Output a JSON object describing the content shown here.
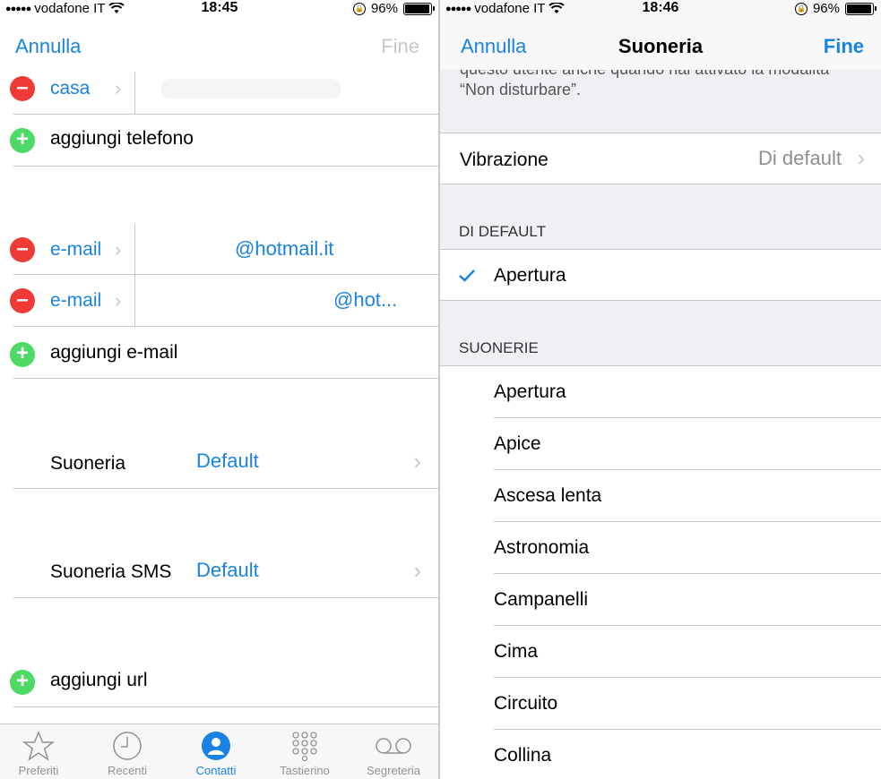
{
  "left": {
    "status": {
      "carrier": "vodafone IT",
      "time": "18:45",
      "battery": "96%"
    },
    "nav": {
      "cancel": "Annulla",
      "done": "Fine"
    },
    "phone_row": {
      "label": "casa"
    },
    "add_phone": "aggiungi telefono",
    "emails": [
      {
        "label": "e-mail",
        "value": "@hotmail.it"
      },
      {
        "label": "e-mail",
        "value": "@hot..."
      }
    ],
    "add_email": "aggiungi e-mail",
    "ringtone": {
      "label": "Suoneria",
      "value": "Default"
    },
    "sms_tone": {
      "label": "Suoneria SMS",
      "value": "Default"
    },
    "add_url": "aggiungi url",
    "tabs": [
      {
        "label": "Preferiti",
        "icon": "star-icon",
        "active": false
      },
      {
        "label": "Recenti",
        "icon": "clock-icon",
        "active": false
      },
      {
        "label": "Contatti",
        "icon": "person-icon",
        "active": true
      },
      {
        "label": "Tastierino",
        "icon": "keypad-icon",
        "active": false
      },
      {
        "label": "Segreteria",
        "icon": "voicemail-icon",
        "active": false
      }
    ]
  },
  "right": {
    "status": {
      "carrier": "vodafone IT",
      "time": "18:46",
      "battery": "96%"
    },
    "nav": {
      "cancel": "Annulla",
      "title": "Suoneria",
      "done": "Fine"
    },
    "note": "questo utente anche quando hai attivato la modalità “Non disturbare”.",
    "vibration": {
      "label": "Vibrazione",
      "value": "Di default"
    },
    "default_header": "DI DEFAULT",
    "default_item": "Apertura",
    "ringtones_header": "SUONERIE",
    "ringtones": [
      "Apertura",
      "Apice",
      "Ascesa lenta",
      "Astronomia",
      "Campanelli",
      "Cima",
      "Circuito",
      "Collina"
    ]
  },
  "colors": {
    "accent": "#1a82e2",
    "delete": "#ef3a35",
    "add": "#4cd964"
  }
}
